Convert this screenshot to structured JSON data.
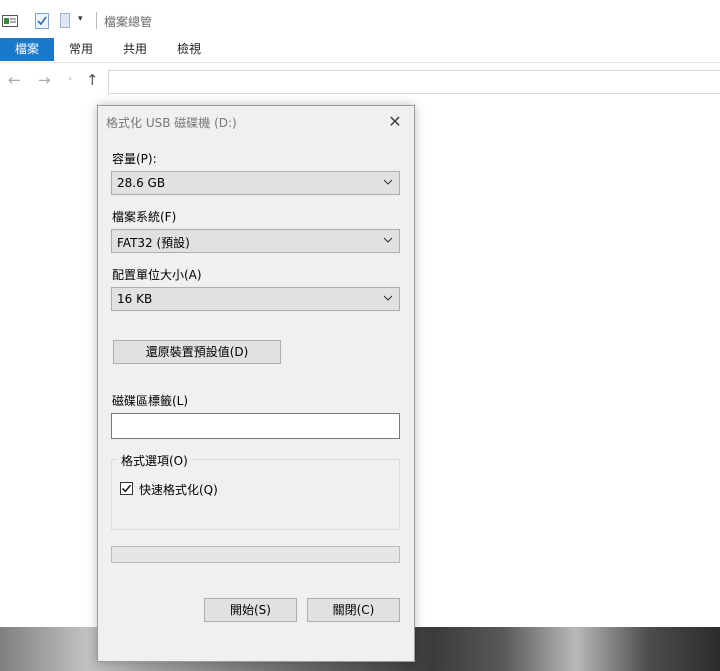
{
  "explorer": {
    "title": "檔案總管",
    "ribbon_tabs": [
      "檔案",
      "常用",
      "共用",
      "檢視"
    ],
    "address_value": ""
  },
  "dialog": {
    "title": "格式化 USB 磁碟機 (D:)",
    "capacity_label": "容量(P):",
    "capacity_value": "28.6 GB",
    "filesystem_label": "檔案系統(F)",
    "filesystem_value": "FAT32 (預設)",
    "allocation_label": "配置單位大小(A)",
    "allocation_value": "16 KB",
    "restore_button": "還原裝置預設值(D)",
    "volume_label": "磁碟區標籤(L)",
    "volume_value": "",
    "options_group": "格式選項(O)",
    "quick_format_label": "快速格式化(Q)",
    "quick_format_checked": true,
    "progress": 0,
    "start_button": "開始(S)",
    "close_button": "關閉(C)"
  },
  "colors": {
    "accent": "#1979ca",
    "dialog_bg": "#f0f0f0",
    "progress_fill": "#06b025"
  }
}
